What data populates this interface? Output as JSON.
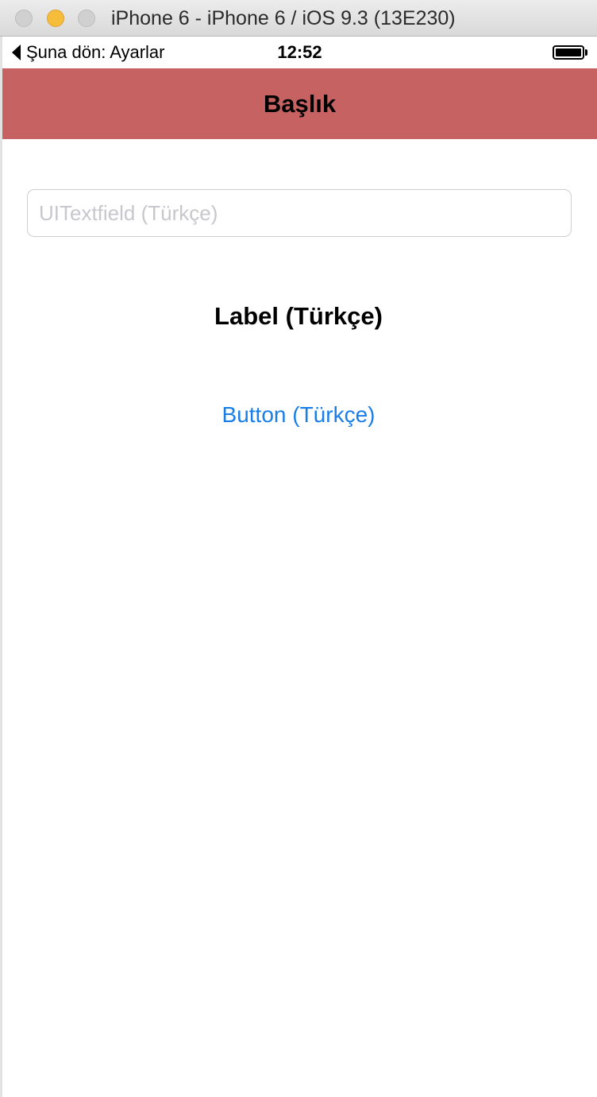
{
  "window": {
    "title": "iPhone 6 - iPhone 6 / iOS 9.3 (13E230)"
  },
  "status_bar": {
    "back_label": "Şuna dön: Ayarlar",
    "time": "12:52",
    "battery_level": 1.0
  },
  "nav_bar": {
    "title": "Başlık",
    "background_color": "#c76262"
  },
  "content": {
    "textfield_placeholder": "UITextfield (Türkçe)",
    "textfield_value": "",
    "label": "Label (Türkçe)",
    "button_label": "Button (Türkçe)",
    "button_color": "#1a7ee8"
  }
}
